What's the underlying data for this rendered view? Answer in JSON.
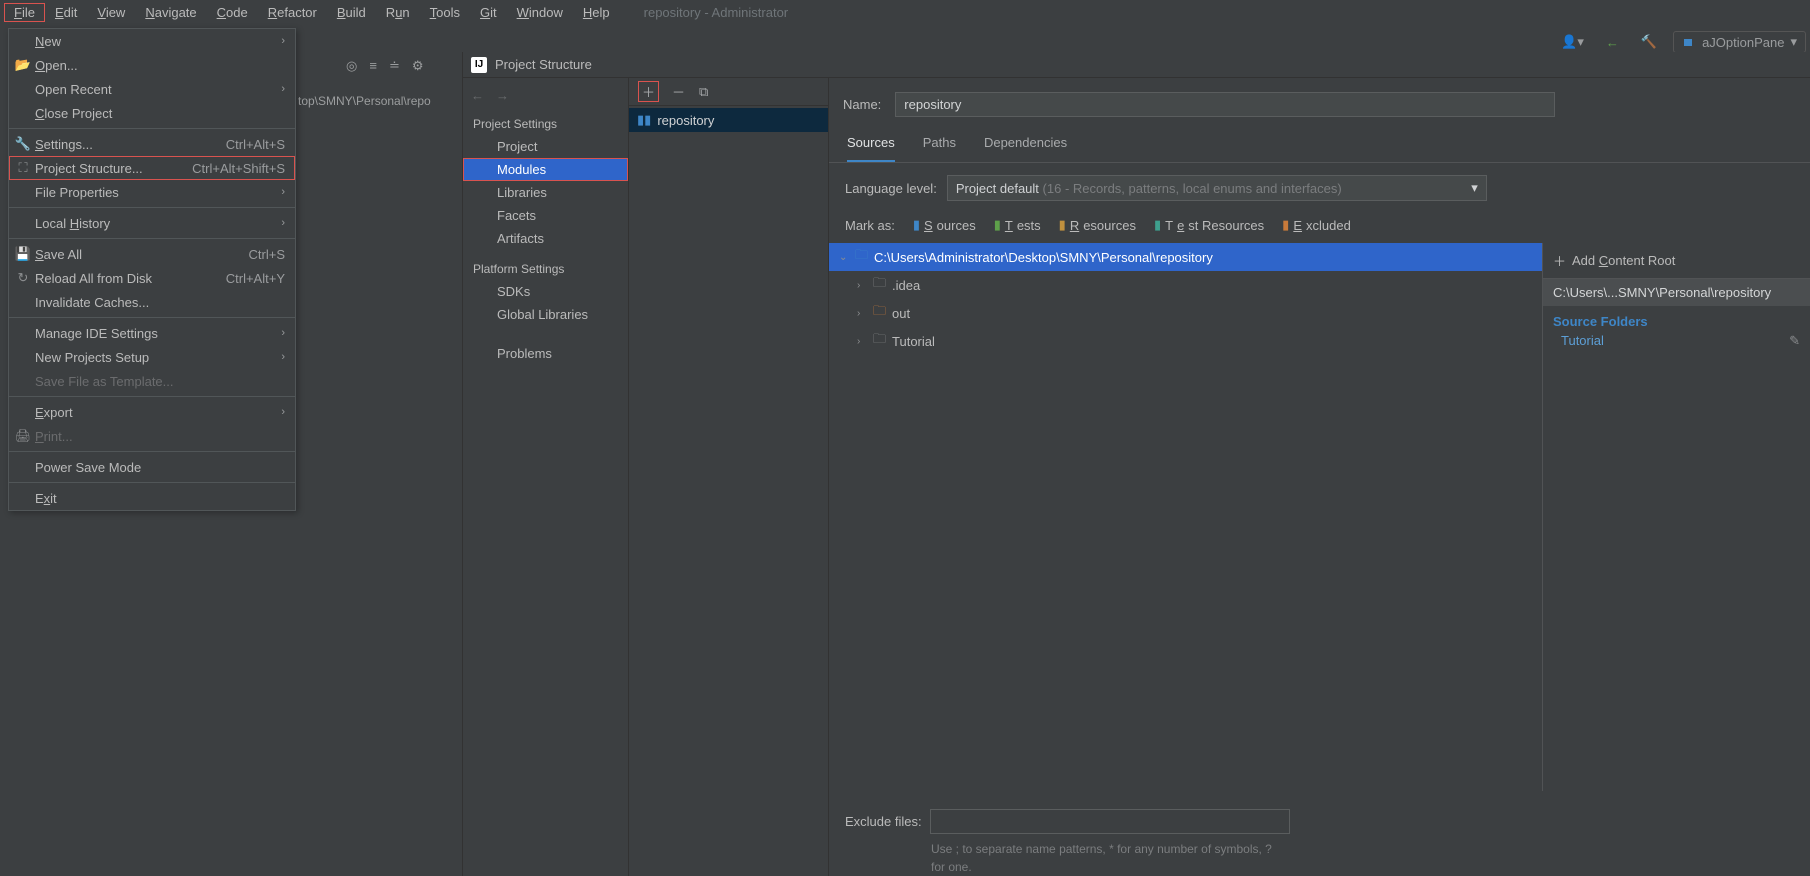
{
  "menubar": {
    "items": [
      {
        "l": "File",
        "u": "F"
      },
      {
        "l": "Edit",
        "u": "E"
      },
      {
        "l": "View",
        "u": "V"
      },
      {
        "l": "Navigate",
        "u": "N"
      },
      {
        "l": "Code",
        "u": "C"
      },
      {
        "l": "Refactor",
        "u": "R"
      },
      {
        "l": "Build",
        "u": "B"
      },
      {
        "l": "Run",
        "u": "u"
      },
      {
        "l": "Tools",
        "u": "T"
      },
      {
        "l": "Git",
        "u": "G"
      },
      {
        "l": "Window",
        "u": "W"
      },
      {
        "l": "Help",
        "u": "H"
      }
    ],
    "title": "repository - Administrator"
  },
  "runcfg": "aJOptionPane",
  "dropdown": [
    {
      "icon": "",
      "label": "New",
      "u": "N",
      "sub": true
    },
    {
      "icon": "📂",
      "label": "Open...",
      "u": "O"
    },
    {
      "icon": "",
      "label": "Open Recent",
      "u": "",
      "sub": true
    },
    {
      "icon": "",
      "label": "Close Project",
      "u": "C"
    },
    {
      "sep": true
    },
    {
      "icon": "🔧",
      "label": "Settings...",
      "u": "S",
      "short": "Ctrl+Alt+S"
    },
    {
      "icon": "⛶",
      "label": "Project Structure...",
      "u": "",
      "short": "Ctrl+Alt+Shift+S",
      "red": true
    },
    {
      "icon": "",
      "label": "File Properties",
      "u": "",
      "sub": true
    },
    {
      "sep": true
    },
    {
      "icon": "",
      "label": "Local History",
      "u": "H",
      "sub": true
    },
    {
      "sep": true
    },
    {
      "icon": "💾",
      "label": "Save All",
      "u": "S",
      "short": "Ctrl+S"
    },
    {
      "icon": "↻",
      "label": "Reload All from Disk",
      "u": "",
      "short": "Ctrl+Alt+Y"
    },
    {
      "icon": "",
      "label": "Invalidate Caches...",
      "u": ""
    },
    {
      "sep": true
    },
    {
      "icon": "",
      "label": "Manage IDE Settings",
      "u": "",
      "sub": true
    },
    {
      "icon": "",
      "label": "New Projects Setup",
      "u": "",
      "sub": true
    },
    {
      "icon": "",
      "label": "Save File as Template...",
      "u": "",
      "disabled": true
    },
    {
      "sep": true
    },
    {
      "icon": "",
      "label": "Export",
      "u": "E",
      "sub": true
    },
    {
      "icon": "🖨",
      "label": "Print...",
      "u": "P",
      "disabled": true
    },
    {
      "sep": true
    },
    {
      "icon": "",
      "label": "Power Save Mode",
      "u": ""
    },
    {
      "sep": true
    },
    {
      "icon": "",
      "label": "Exit",
      "u": "x"
    }
  ],
  "breadcrumb": "top\\SMNY\\Personal\\repo",
  "dialog": {
    "title": "Project Structure",
    "nav": {
      "projectSettings": "Project Settings",
      "project": "Project",
      "modules": "Modules",
      "libraries": "Libraries",
      "facets": "Facets",
      "artifacts": "Artifacts",
      "platformSettings": "Platform Settings",
      "sdks": "SDKs",
      "globlibs": "Global Libraries",
      "problems": "Problems"
    },
    "module": "repository",
    "nameLabel": "Name:",
    "nameValue": "repository",
    "tabs": {
      "sources": "Sources",
      "paths": "Paths",
      "deps": "Dependencies"
    },
    "langLabel": "Language level:",
    "langValue": "Project default",
    "langHint": "(16 - Records, patterns, local enums and interfaces)",
    "markAs": "Mark as:",
    "marks": {
      "sources": "Sources",
      "tests": "Tests",
      "resources": "Resources",
      "tres": "Test Resources",
      "excluded": "Excluded"
    },
    "tree": {
      "root": "C:\\Users\\Administrator\\Desktop\\SMNY\\Personal\\repository",
      "children": [
        {
          "name": ".idea",
          "color": "grey"
        },
        {
          "name": "out",
          "color": "orange"
        },
        {
          "name": "Tutorial",
          "color": "grey"
        }
      ]
    },
    "addRoot": "Add Content Root",
    "rootPath": "C:\\Users\\...SMNY\\Personal\\repository",
    "sourceFoldersTitle": "Source Folders",
    "sourceFolders": [
      "Tutorial"
    ],
    "excludeLabel": "Exclude files:",
    "excludeHint": "Use ; to separate name patterns, * for any number of symbols, ? for one."
  }
}
